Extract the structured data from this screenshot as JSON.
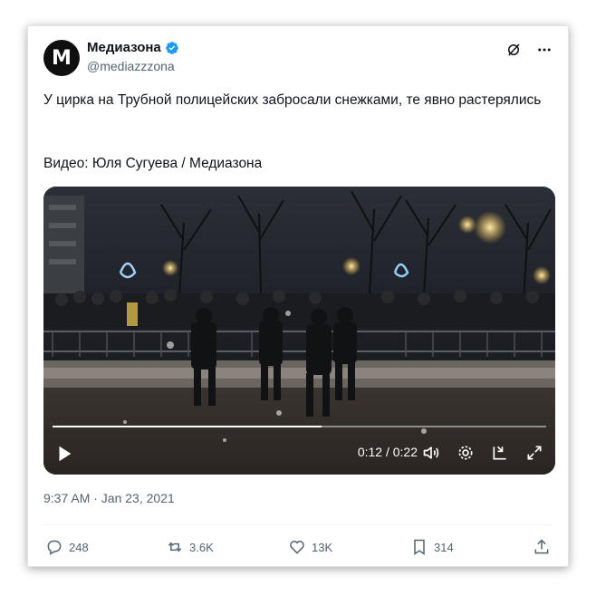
{
  "account": {
    "name": "Медиазона",
    "handle": "@mediazzzona",
    "avatar_letter": "M"
  },
  "tweet": {
    "text": "У цирка на Трубной полицейских забросали снежками, те явно растерялись",
    "credit": "Видео: Юля Сугуева / Медиазона",
    "timestamp": "9:37 AM · Jan 23, 2021"
  },
  "video": {
    "current_time": "0:12",
    "duration": "0:22",
    "time_display": "0:12 / 0:22",
    "progress": 0.545
  },
  "actions": {
    "replies": "248",
    "reposts": "3.6K",
    "likes": "13K",
    "bookmarks": "314"
  },
  "colors": {
    "verified": "#1d9bf0",
    "text": "#0f1419",
    "secondary": "#536471"
  },
  "icons": [
    "grok-icon",
    "more-icon",
    "verified-badge-icon",
    "play-icon",
    "volume-icon",
    "settings-icon",
    "pip-icon",
    "fullscreen-icon",
    "reply-icon",
    "repost-icon",
    "like-icon",
    "bookmark-icon",
    "share-icon"
  ]
}
